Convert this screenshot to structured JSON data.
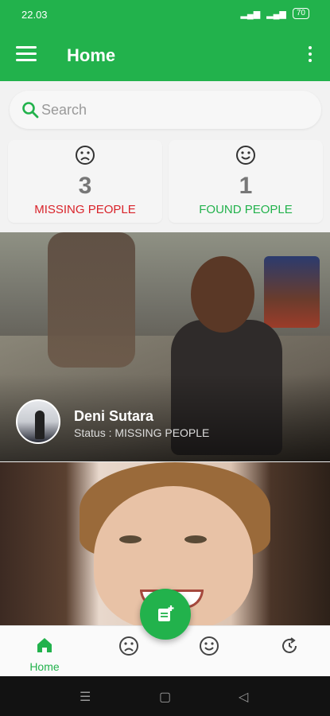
{
  "status_bar": {
    "time": "22.03",
    "battery": "70"
  },
  "appbar": {
    "title": "Home"
  },
  "search": {
    "placeholder": "Search"
  },
  "stats": {
    "missing": {
      "count": "3",
      "label": "MISSING PEOPLE"
    },
    "found": {
      "count": "1",
      "label": "FOUND PEOPLE"
    }
  },
  "cards": [
    {
      "name": "Deni Sutara",
      "status": "Status : MISSING PEOPLE"
    }
  ],
  "bottom_nav": {
    "items": [
      {
        "label": "Home",
        "icon": "home-icon",
        "active": true
      },
      {
        "label": "",
        "icon": "sad-face-icon"
      },
      {
        "label": "",
        "icon": "smile-face-icon"
      },
      {
        "label": "",
        "icon": "history-icon"
      }
    ]
  },
  "colors": {
    "primary": "#22b24c",
    "missing": "#d9232a"
  }
}
